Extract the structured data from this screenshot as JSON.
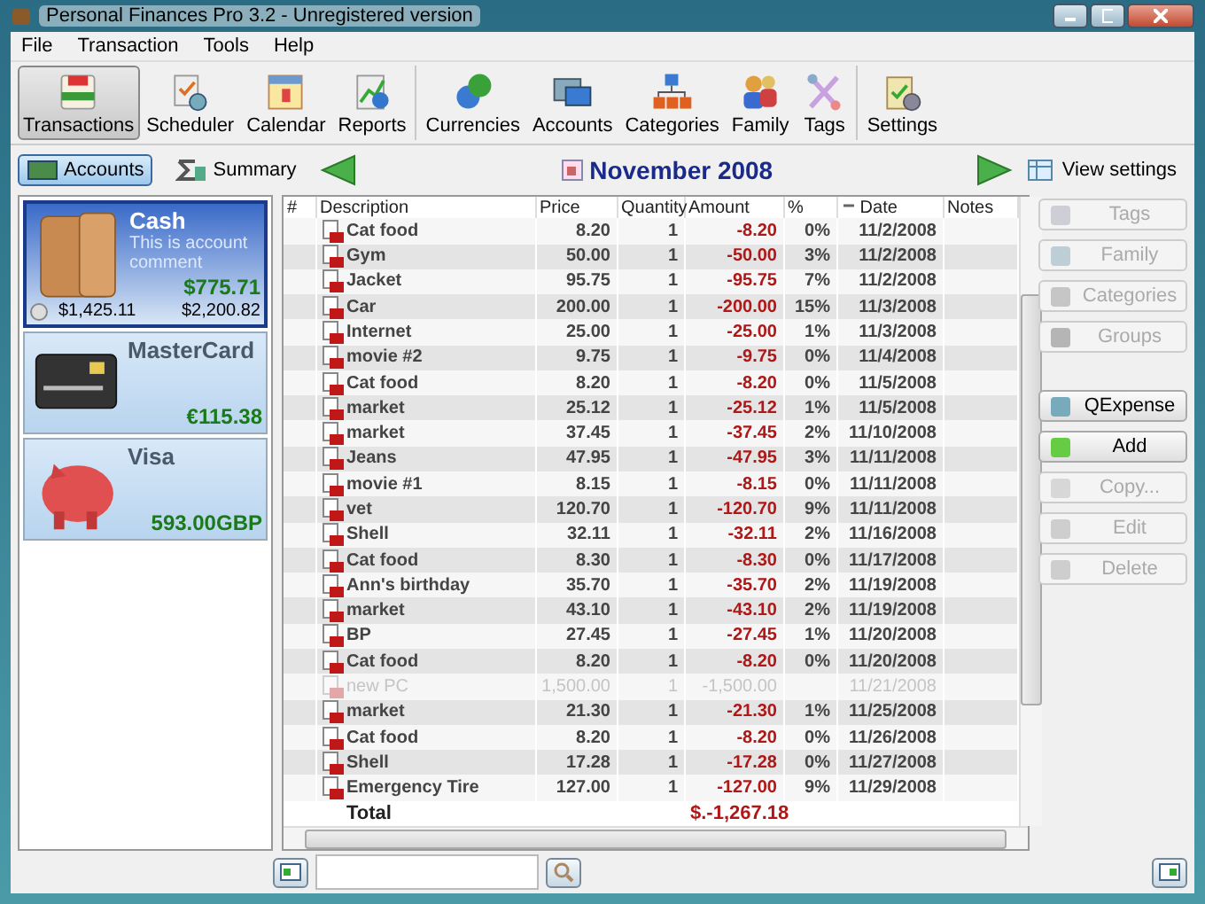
{
  "window": {
    "title": "Personal Finances Pro 3.2 - Unregistered version"
  },
  "menu": [
    "File",
    "Transaction",
    "Tools",
    "Help"
  ],
  "toolbar": {
    "groups": [
      [
        {
          "label": "Transactions",
          "selected": true
        },
        {
          "label": "Scheduler",
          "selected": false
        },
        {
          "label": "Calendar",
          "selected": false
        },
        {
          "label": "Reports",
          "selected": false
        }
      ],
      [
        {
          "label": "Currencies",
          "selected": false
        },
        {
          "label": "Accounts",
          "selected": false
        },
        {
          "label": "Categories",
          "selected": false
        },
        {
          "label": "Family",
          "selected": false
        },
        {
          "label": "Tags",
          "selected": false
        }
      ],
      [
        {
          "label": "Settings",
          "selected": false
        }
      ]
    ]
  },
  "view_tabs": [
    {
      "label": "Accounts",
      "selected": true
    },
    {
      "label": "Summary",
      "selected": false
    }
  ],
  "period": "November 2008",
  "view_settings": "View settings",
  "accounts": [
    {
      "kind": "wallet",
      "name": "Cash",
      "comment": "This is account comment",
      "balance": "$775.71",
      "selected": true,
      "footer": [
        "$1,425.11",
        "$2,200.82"
      ]
    },
    {
      "kind": "card",
      "name": "MasterCard",
      "balance": "€115.38",
      "selected": false
    },
    {
      "kind": "piggy",
      "name": "Visa",
      "balance": "593.00GBP",
      "selected": false
    }
  ],
  "table": {
    "columns": [
      "#",
      "Description",
      "Price",
      "Quantity",
      "Amount",
      "%",
      "Date",
      "Notes"
    ],
    "rows": [
      {
        "description": "Cat food",
        "price": "8.20",
        "quantity": "1",
        "amount": "-8.20",
        "percent": "0%",
        "date": "11/2/2008",
        "disabled": false
      },
      {
        "description": "Gym",
        "price": "50.00",
        "quantity": "1",
        "amount": "-50.00",
        "percent": "3%",
        "date": "11/2/2008",
        "disabled": false
      },
      {
        "description": "Jacket",
        "price": "95.75",
        "quantity": "1",
        "amount": "-95.75",
        "percent": "7%",
        "date": "11/2/2008",
        "disabled": false
      },
      {
        "description": "Car",
        "price": "200.00",
        "quantity": "1",
        "amount": "-200.00",
        "percent": "15%",
        "date": "11/3/2008",
        "disabled": false
      },
      {
        "description": "Internet",
        "price": "25.00",
        "quantity": "1",
        "amount": "-25.00",
        "percent": "1%",
        "date": "11/3/2008",
        "disabled": false
      },
      {
        "description": "movie #2",
        "price": "9.75",
        "quantity": "1",
        "amount": "-9.75",
        "percent": "0%",
        "date": "11/4/2008",
        "disabled": false
      },
      {
        "description": "Cat food",
        "price": "8.20",
        "quantity": "1",
        "amount": "-8.20",
        "percent": "0%",
        "date": "11/5/2008",
        "disabled": false
      },
      {
        "description": "market",
        "price": "25.12",
        "quantity": "1",
        "amount": "-25.12",
        "percent": "1%",
        "date": "11/5/2008",
        "disabled": false
      },
      {
        "description": "market",
        "price": "37.45",
        "quantity": "1",
        "amount": "-37.45",
        "percent": "2%",
        "date": "11/10/2008",
        "disabled": false
      },
      {
        "description": "Jeans",
        "price": "47.95",
        "quantity": "1",
        "amount": "-47.95",
        "percent": "3%",
        "date": "11/11/2008",
        "disabled": false
      },
      {
        "description": "movie #1",
        "price": "8.15",
        "quantity": "1",
        "amount": "-8.15",
        "percent": "0%",
        "date": "11/11/2008",
        "disabled": false
      },
      {
        "description": "vet",
        "price": "120.70",
        "quantity": "1",
        "amount": "-120.70",
        "percent": "9%",
        "date": "11/11/2008",
        "disabled": false
      },
      {
        "description": "Shell",
        "price": "32.11",
        "quantity": "1",
        "amount": "-32.11",
        "percent": "2%",
        "date": "11/16/2008",
        "disabled": false
      },
      {
        "description": "Cat food",
        "price": "8.30",
        "quantity": "1",
        "amount": "-8.30",
        "percent": "0%",
        "date": "11/17/2008",
        "disabled": false
      },
      {
        "description": "Ann's birthday",
        "price": "35.70",
        "quantity": "1",
        "amount": "-35.70",
        "percent": "2%",
        "date": "11/19/2008",
        "disabled": false
      },
      {
        "description": "market",
        "price": "43.10",
        "quantity": "1",
        "amount": "-43.10",
        "percent": "2%",
        "date": "11/19/2008",
        "disabled": false
      },
      {
        "description": "BP",
        "price": "27.45",
        "quantity": "1",
        "amount": "-27.45",
        "percent": "1%",
        "date": "11/20/2008",
        "disabled": false
      },
      {
        "description": "Cat food",
        "price": "8.20",
        "quantity": "1",
        "amount": "-8.20",
        "percent": "0%",
        "date": "11/20/2008",
        "disabled": false
      },
      {
        "description": "new PC",
        "price": "1,500.00",
        "quantity": "1",
        "amount": "-1,500.00",
        "date": "11/21/2008",
        "disabled": true
      },
      {
        "description": "market",
        "price": "21.30",
        "quantity": "1",
        "amount": "-21.30",
        "percent": "1%",
        "date": "11/25/2008",
        "disabled": false
      },
      {
        "description": "Cat food",
        "price": "8.20",
        "quantity": "1",
        "amount": "-8.20",
        "percent": "0%",
        "date": "11/26/2008",
        "disabled": false
      },
      {
        "description": "Shell",
        "price": "17.28",
        "quantity": "1",
        "amount": "-17.28",
        "percent": "0%",
        "date": "11/27/2008",
        "disabled": false
      },
      {
        "description": "Emergency Tire",
        "price": "127.00",
        "quantity": "1",
        "amount": "-127.00",
        "percent": "9%",
        "date": "11/29/2008",
        "disabled": false
      }
    ],
    "total_label": "Total",
    "total_amount": "$.-1,267.18"
  },
  "side_buttons": [
    {
      "label": "Tags",
      "disabled": true
    },
    {
      "label": "Family",
      "disabled": true
    },
    {
      "label": "Categories",
      "disabled": true
    },
    {
      "label": "Groups",
      "disabled": true
    },
    {
      "label": "QExpense",
      "disabled": false
    },
    {
      "label": "Add",
      "disabled": false
    },
    {
      "label": "Copy...",
      "disabled": true
    },
    {
      "label": "Edit",
      "disabled": true
    },
    {
      "label": "Delete",
      "disabled": true
    }
  ]
}
